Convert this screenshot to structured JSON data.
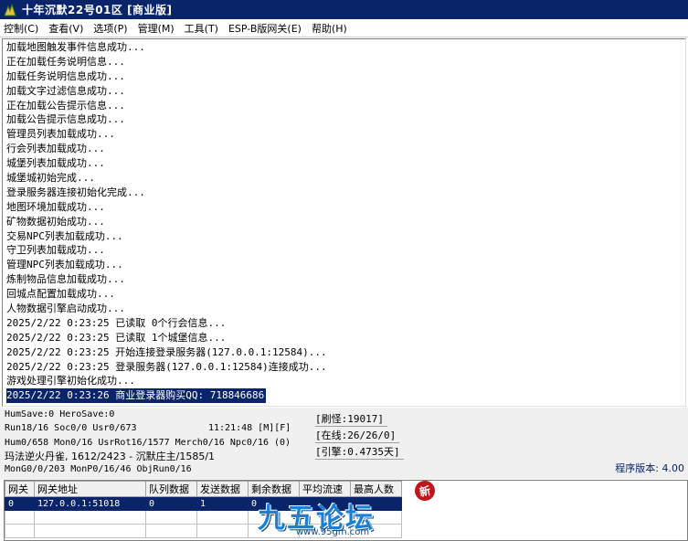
{
  "window": {
    "title": "十年沉默22号01区 [商业版]"
  },
  "menu": [
    "控制(C)",
    "查看(V)",
    "选项(P)",
    "管理(M)",
    "工具(T)",
    "ESP-B版网关(E)",
    "帮助(H)"
  ],
  "log": [
    "加载地图触发事件信息成功...",
    "正在加载任务说明信息...",
    "加载任务说明信息成功...",
    "加载文字过滤信息成功...",
    "正在加载公告提示信息...",
    "加载公告提示信息成功...",
    "管理员列表加载成功...",
    "行会列表加载成功...",
    "城堡列表加载成功...",
    "城堡城初始完成...",
    "登录服务器连接初始化完成...",
    "地图环境加载成功...",
    "矿物数据初始成功...",
    "交易NPC列表加载成功...",
    "守卫列表加载成功...",
    "管理NPC列表加载成功...",
    "炼制物品信息加载成功...",
    "回城点配置加载成功...",
    "人物数据引擎启动成功...",
    "2025/2/22 0:23:25 已读取 0个行会信息...",
    "2025/2/22 0:23:25 已读取 1个城堡信息...",
    "2025/2/22 0:23:25 开始连接登录服务器(127.0.0.1:12584)...",
    "2025/2/22 0:23:25 登录服务器(127.0.0.1:12584)连接成功...",
    "游戏处理引擎初始化成功..."
  ],
  "log_selected": "2025/2/22 0:23:26 商业登录器购买QQ: 718846686",
  "status": {
    "hum_save": "HumSave:0 HeroSave:0",
    "run": "Run18/16 Soc0/0 Usr0/673",
    "clock": "11:21:48 [M][F]",
    "hum": "Hum0/658 Mon0/16 UsrRot16/1577 Merch0/16 Npc0/16 (0)",
    "player": "玛法逆火丹雀, 1612/2423 - 沉默庄主/1585/1",
    "mon": "MonG0/0/203 MonP0/16/46 ObjRun0/16",
    "refresh": "[刷怪:19017]",
    "online": "[在线:26/26/0]",
    "engine": "[引擎:0.4735天]",
    "version": "程序版本: 4.00"
  },
  "grid": {
    "columns": [
      "网关",
      "网关地址",
      "队列数据",
      "发送数据",
      "剩余数据",
      "平均流速",
      "最高人数"
    ],
    "rows": [
      [
        "0",
        "127.0.0.1:51018",
        "0",
        "1",
        "0",
        "",
        ""
      ]
    ]
  },
  "watermark": {
    "text": "九五论坛",
    "url": "www.95gm.com",
    "badge": "新"
  }
}
